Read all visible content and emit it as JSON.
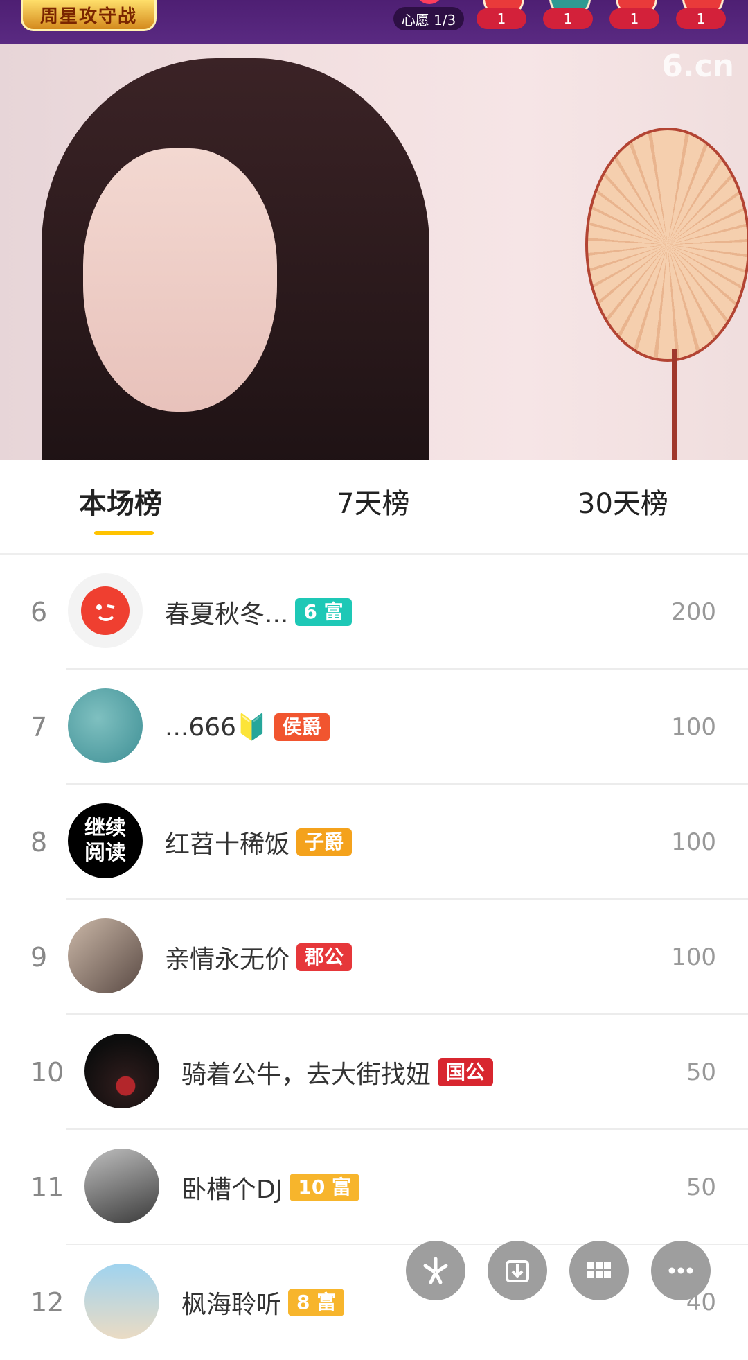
{
  "topbar": {
    "logo_text": "周星攻守战",
    "wish_label": "心愿 1/3",
    "badges": [
      "1",
      "1",
      "1",
      "1"
    ]
  },
  "stream": {
    "watermark": "6.cn"
  },
  "tabs": [
    {
      "label": "本场榜",
      "active": true
    },
    {
      "label": "7天榜",
      "active": false
    },
    {
      "label": "30天榜",
      "active": false
    }
  ],
  "ranking": [
    {
      "rank": "6",
      "name": "春夏秋冬...",
      "tag": "6 富",
      "tag_color": "#1ec8b6",
      "score": "200",
      "avatar": "smile-avatar"
    },
    {
      "rank": "7",
      "name": "...666🔰",
      "tag": "侯爵",
      "tag_color": "#f1552f",
      "score": "100",
      "avatar": "water-drops-avatar"
    },
    {
      "rank": "8",
      "name": "红苕十稀饭",
      "tag": "子爵",
      "tag_color": "#f4a21c",
      "score": "100",
      "avatar_text": "继续\n阅读"
    },
    {
      "rank": "9",
      "name": "亲情永无价",
      "tag": "郡公",
      "tag_color": "#e6373a",
      "score": "100",
      "avatar": "couple-avatar"
    },
    {
      "rank": "10",
      "name": "骑着公牛，去大街找妞",
      "tag": "国公",
      "tag_color": "#d8262f",
      "score": "50",
      "avatar": "hat-woman-avatar"
    },
    {
      "rank": "11",
      "name": "卧槽个DJ",
      "tag": "10 富",
      "tag_color": "#f7b52c",
      "score": "50",
      "avatar": "desk-avatar"
    },
    {
      "rank": "12",
      "name": "枫海聆听",
      "tag": "8 富",
      "tag_color": "#f7b52c",
      "score": "40",
      "avatar": "beach-couple-avatar"
    }
  ],
  "fabs": [
    "six-logo-icon",
    "download-icon",
    "grid-icon",
    "more-icon"
  ]
}
